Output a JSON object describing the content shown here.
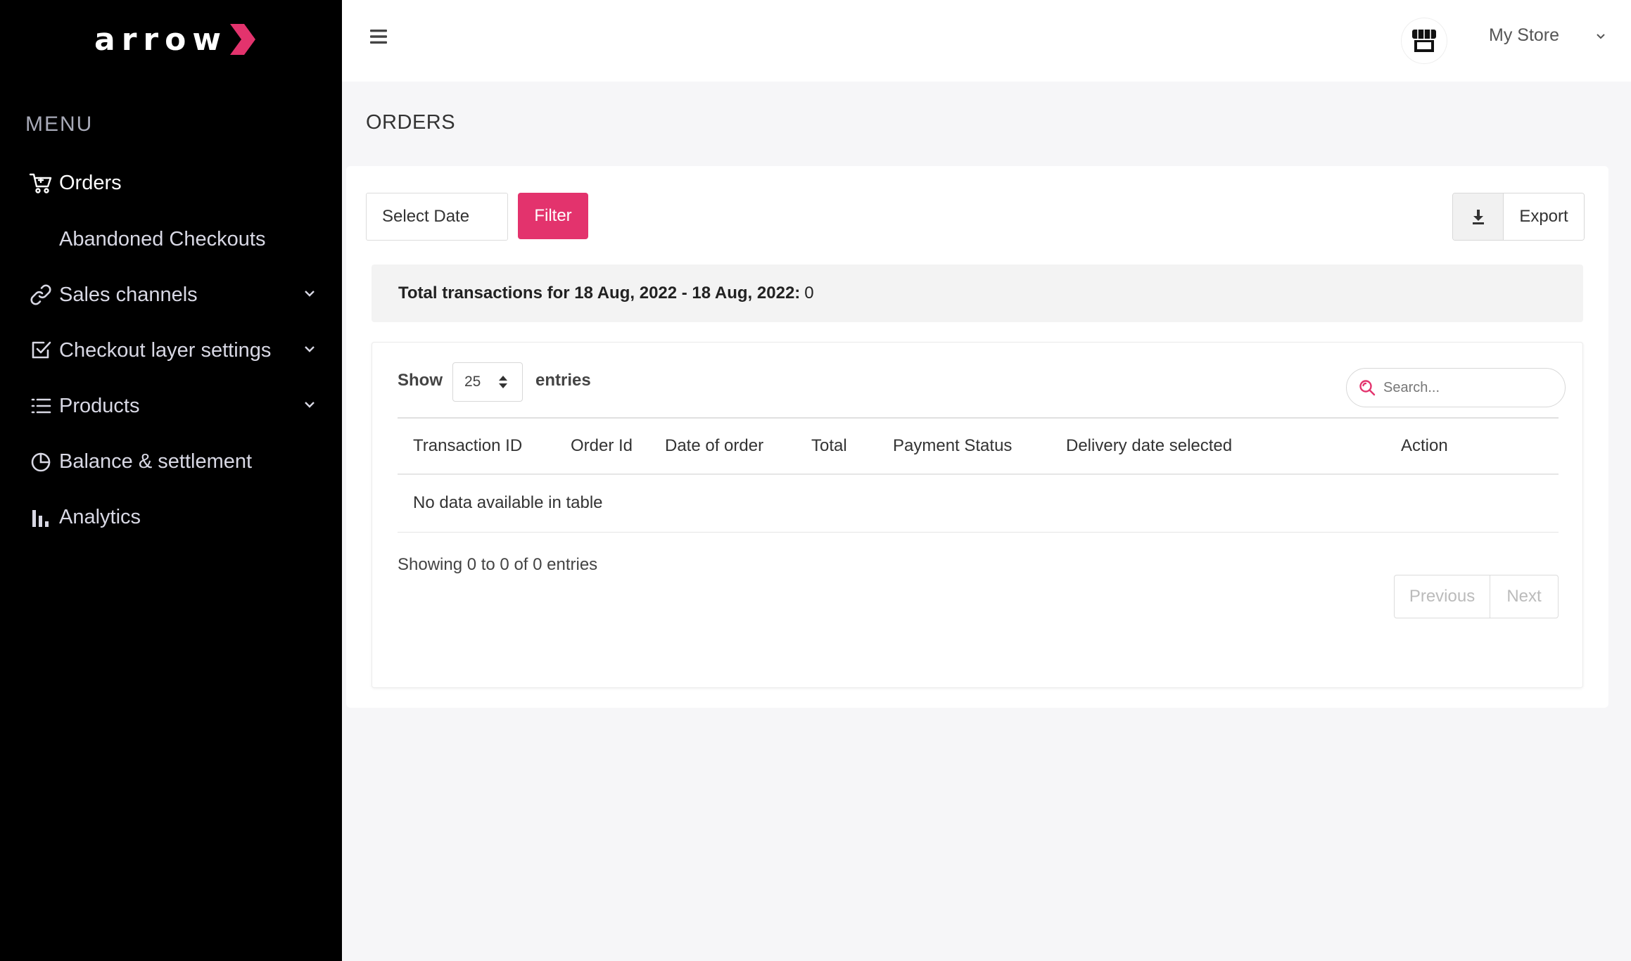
{
  "brand": {
    "logo_text": "arrow",
    "accent": "#e3336d"
  },
  "sidebar": {
    "menu_heading": "MENU",
    "items": [
      {
        "label": "Orders",
        "icon": "cart-icon",
        "active": true
      },
      {
        "label": "Abandoned Checkouts",
        "sub": true
      },
      {
        "label": "Sales channels",
        "icon": "link-icon",
        "has_caret": true
      },
      {
        "label": "Checkout layer settings",
        "icon": "checkbox-icon",
        "has_caret": true
      },
      {
        "label": "Products",
        "icon": "list-icon",
        "has_caret": true
      },
      {
        "label": "Balance & settlement",
        "icon": "pie-clock-icon"
      },
      {
        "label": "Analytics",
        "icon": "bar-chart-icon"
      }
    ]
  },
  "topbar": {
    "store_name": "My Store",
    "store_icon": "store-icon"
  },
  "page": {
    "title": "ORDERS",
    "date_placeholder": "Select Date",
    "filter_label": "Filter",
    "export_label": "Export",
    "summary_label": "Total transactions for 18 Aug, 2022 - 18 Aug, 2022:",
    "summary_value": "0"
  },
  "table": {
    "show_label": "Show",
    "entries_value": "25",
    "entries_label": "entries",
    "search_placeholder": "Search...",
    "columns": [
      "Transaction ID",
      "Order Id",
      "Date of order",
      "Total",
      "Payment Status",
      "Delivery date selected",
      "Action"
    ],
    "empty_text": "No data available in table",
    "showing_text": "Showing 0 to 0 of 0 entries",
    "prev_label": "Previous",
    "next_label": "Next"
  }
}
